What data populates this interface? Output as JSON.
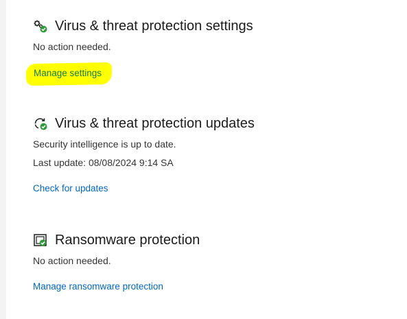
{
  "sections": [
    {
      "title": "Virus & threat protection settings",
      "icon": "gears-check-icon",
      "lines": [
        "No action needed."
      ],
      "link": "Manage settings"
    },
    {
      "title": "Virus & threat protection updates",
      "icon": "refresh-check-icon",
      "lines": [
        "Security intelligence is up to date.",
        "Last update: 08/08/2024 9:14 SA"
      ],
      "link": "Check for updates"
    },
    {
      "title": "Ransomware protection",
      "icon": "ransomware-shield-icon",
      "lines": [
        "No action needed."
      ],
      "link": "Manage ransomware protection"
    }
  ],
  "colors": {
    "link": "#0067c0",
    "highlight": "#ffff00",
    "check_green": "#2e9a3a"
  }
}
